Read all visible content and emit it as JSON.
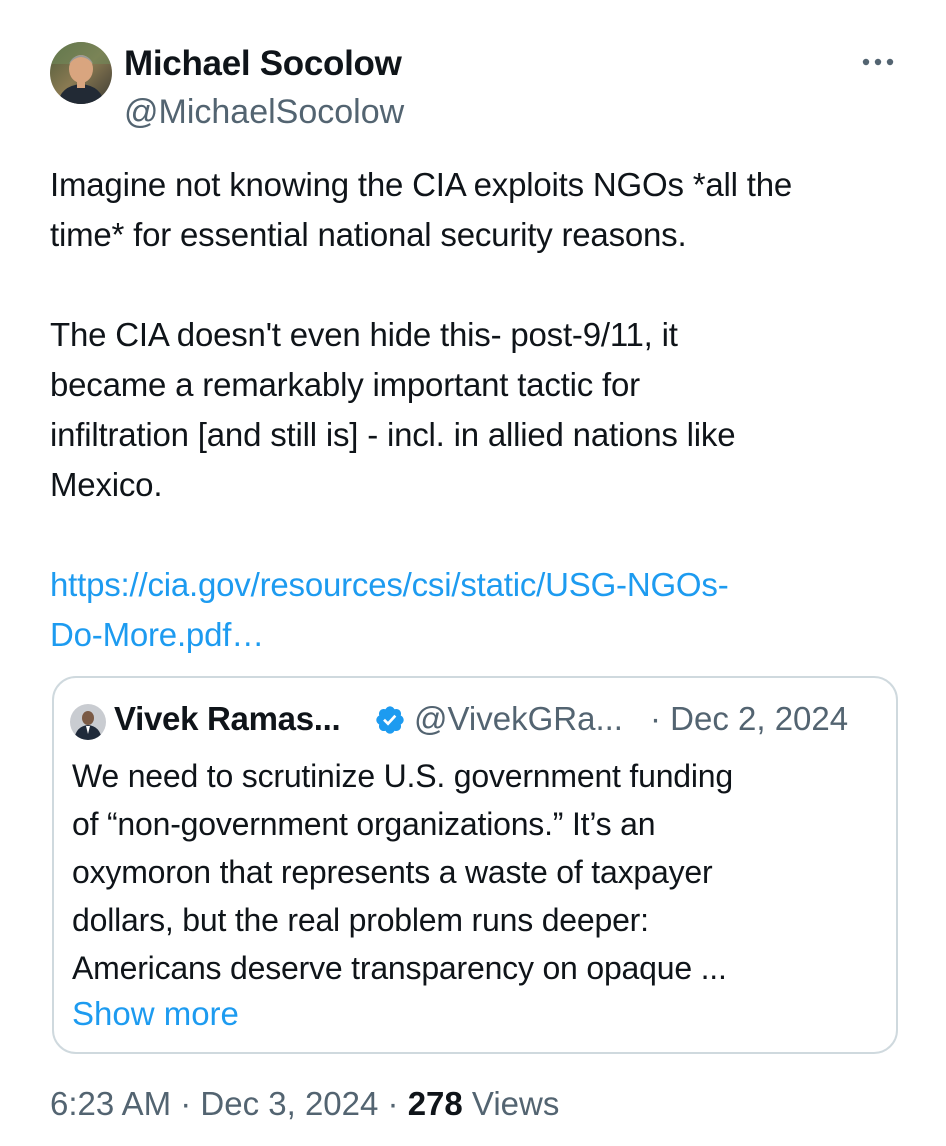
{
  "author": {
    "name": "Michael Socolow",
    "handle": "@MichaelSocolow",
    "avatar_icon": "profile-photo"
  },
  "menu": {
    "more_icon": "more-horizontal-icon",
    "more_glyph": "•••"
  },
  "tweet": {
    "paragraph1": [
      "Imagine not knowing the CIA exploits NGOs *all the",
      "time* for essential national security reasons."
    ],
    "paragraph2": [
      "The CIA doesn't even hide this- post-9/11, it",
      "became a remarkably important tactic for",
      "infiltration [and still is] - incl. in allied nations like",
      "Mexico."
    ],
    "link": [
      "https://cia.gov/resources/csi/static/USG-NGOs-",
      "Do-More.pdf…"
    ]
  },
  "quote": {
    "name": "Vivek Ramas...",
    "handle": "@VivekGRa...",
    "date": "· Dec 2, 2024",
    "verified_icon": "verified-badge-icon",
    "text": [
      "We need to scrutinize U.S. government funding",
      "of “non-government organizations.” It’s an",
      "oxymoron that represents a waste of taxpayer",
      "dollars, but the real problem runs deeper:",
      "Americans deserve transparency on opaque ..."
    ],
    "show_more": "Show more"
  },
  "meta": {
    "time": "6:23 AM",
    "sep1": " · ",
    "date": "Dec 3, 2024",
    "sep2": " · ",
    "views_count": "278",
    "views_label": " Views"
  },
  "colors": {
    "text": "#0f1419",
    "secondary": "#536471",
    "link": "#1d9bf0",
    "verified": "#1d9bf0",
    "border": "#cfd9de"
  }
}
